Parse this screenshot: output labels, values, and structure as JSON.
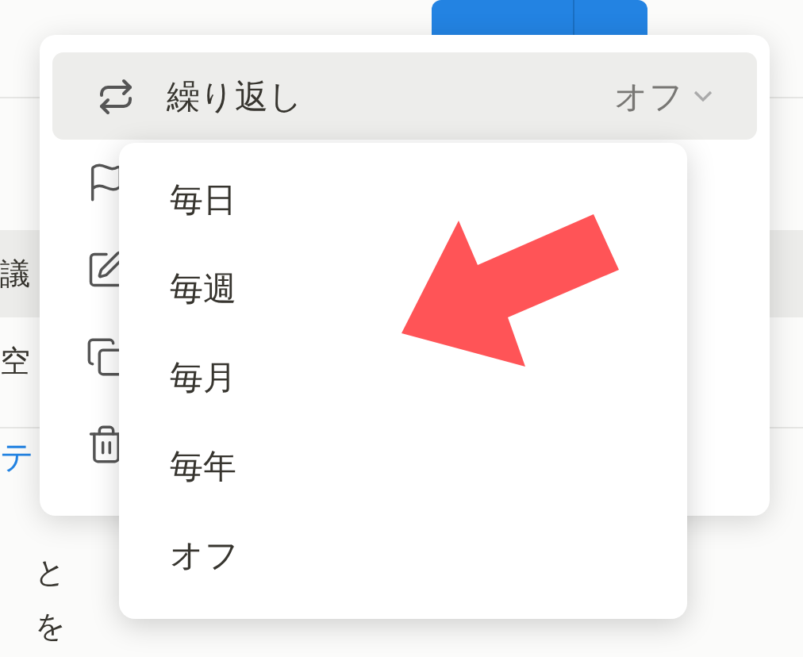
{
  "background": {
    "rows": [
      {
        "text": "議",
        "selected": true
      },
      {
        "text": "空",
        "selected": false
      }
    ],
    "link": "テ",
    "notes": [
      "と",
      "を"
    ]
  },
  "menu": {
    "repeat": {
      "label": "繰り返し",
      "value": "オフ"
    },
    "items": [
      {
        "kind": "flag"
      },
      {
        "kind": "edit"
      },
      {
        "kind": "copy"
      },
      {
        "kind": "trash"
      }
    ]
  },
  "submenu": {
    "options": [
      "毎日",
      "毎週",
      "毎月",
      "毎年",
      "オフ"
    ]
  }
}
